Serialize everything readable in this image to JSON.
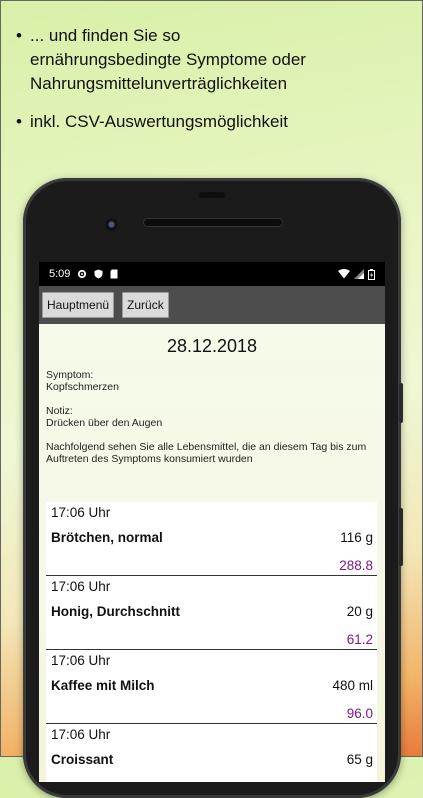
{
  "promo": {
    "bullets": [
      {
        "dot": "•",
        "text": "... und finden Sie so\nernährungsbedingte Symptome oder\nNahrungsmittelunverträglichkeiten"
      },
      {
        "dot": "•",
        "text": "inkl. CSV-Auswertungsmöglichkeit"
      }
    ]
  },
  "status": {
    "time": "5:09"
  },
  "toolbar": {
    "main_menu_label": "Hauptmenü",
    "back_label": "Zurück"
  },
  "entry": {
    "date": "28.12.2018",
    "symptom_label": "Symptom:",
    "symptom_value": "Kopfschmerzen",
    "note_label": "Notiz:",
    "note_value": "Drücken über den Augen",
    "info": "Nachfolgend sehen Sie alle Lebensmittel, die an diesem Tag bis zum Auftreten des Symptoms konsumiert wurden"
  },
  "foods": [
    {
      "time": "17:06 Uhr",
      "name": "Brötchen, normal",
      "amount": "116 g",
      "kcal": "288.8"
    },
    {
      "time": "17:06 Uhr",
      "name": "Honig, Durchschnitt",
      "amount": "20 g",
      "kcal": "61.2"
    },
    {
      "time": "17:06 Uhr",
      "name": "Kaffee mit Milch",
      "amount": "480 ml",
      "kcal": "96.0"
    },
    {
      "time": "17:06 Uhr",
      "name": "Croissant",
      "amount": "65 g",
      "kcal": ""
    }
  ],
  "icons": [
    "gear-icon",
    "shield-icon",
    "sd-card-icon",
    "wifi-icon",
    "signal-icon",
    "battery-icon"
  ],
  "colors": {
    "toolbar": "#4d4d4d",
    "kcal": "#7a1a8a",
    "statusbar": "#000000"
  }
}
